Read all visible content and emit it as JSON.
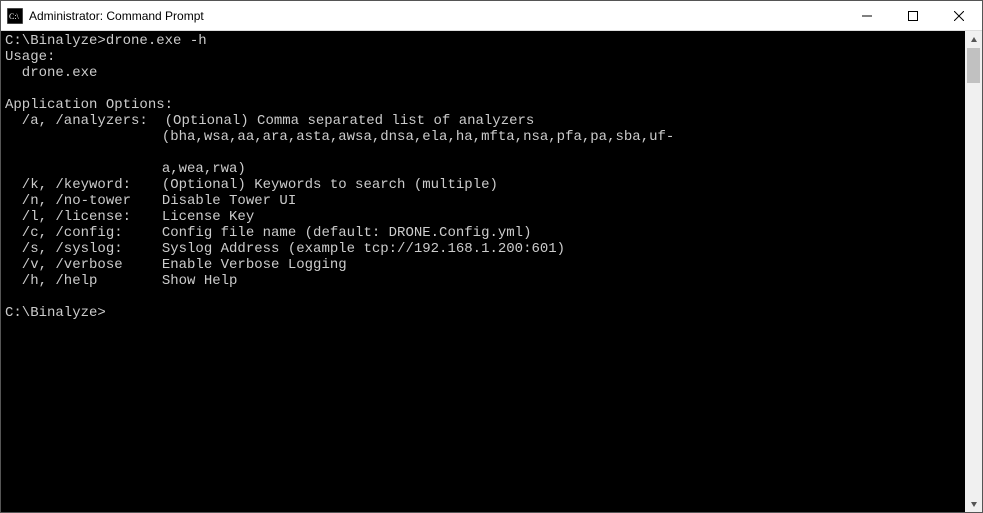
{
  "window": {
    "title": "Administrator: Command Prompt"
  },
  "terminal": {
    "prompt1": "C:\\Binalyze>",
    "command": "drone.exe -h",
    "usage_heading": "Usage:",
    "usage_line": "  drone.exe",
    "options_heading": "Application Options:",
    "options": [
      {
        "flags": "  /a, /analyzers:",
        "desc": "(Optional) Comma separated list of analyzers"
      },
      {
        "flags": "",
        "desc": "(bha,wsa,aa,ara,asta,awsa,dnsa,ela,ha,mfta,nsa,pfa,pa,sba,uf-"
      },
      {
        "flags": "",
        "desc": ""
      },
      {
        "flags": "",
        "desc": "a,wea,rwa)"
      },
      {
        "flags": "  /k, /keyword:",
        "desc": "(Optional) Keywords to search (multiple)"
      },
      {
        "flags": "  /n, /no-tower",
        "desc": "Disable Tower UI"
      },
      {
        "flags": "  /l, /license:",
        "desc": "License Key"
      },
      {
        "flags": "  /c, /config:",
        "desc": "Config file name (default: DRONE.Config.yml)"
      },
      {
        "flags": "  /s, /syslog:",
        "desc": "Syslog Address (example tcp://192.168.1.200:601)"
      },
      {
        "flags": "  /v, /verbose",
        "desc": "Enable Verbose Logging"
      },
      {
        "flags": "  /h, /help",
        "desc": "Show Help"
      }
    ],
    "prompt2": "C:\\Binalyze>"
  }
}
